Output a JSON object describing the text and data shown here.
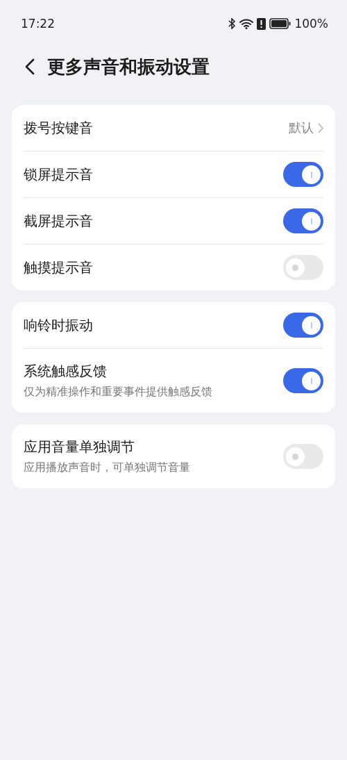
{
  "status_bar": {
    "time": "17:22",
    "battery": "100%"
  },
  "header": {
    "title": "更多声音和振动设置"
  },
  "groups": [
    {
      "items": [
        {
          "kind": "link",
          "label": "拨号按键音",
          "value": "默认"
        },
        {
          "kind": "toggle",
          "label": "锁屏提示音",
          "on": true
        },
        {
          "kind": "toggle",
          "label": "截屏提示音",
          "on": true
        },
        {
          "kind": "toggle",
          "label": "触摸提示音",
          "on": false
        }
      ]
    },
    {
      "items": [
        {
          "kind": "toggle",
          "label": "响铃时振动",
          "on": true
        },
        {
          "kind": "toggle",
          "label": "系统触感反馈",
          "subtitle": "仅为精准操作和重要事件提供触感反馈",
          "on": true
        }
      ]
    },
    {
      "items": [
        {
          "kind": "toggle",
          "label": "应用音量单独调节",
          "subtitle": "应用播放声音时，可单独调节音量",
          "on": false
        }
      ]
    }
  ]
}
